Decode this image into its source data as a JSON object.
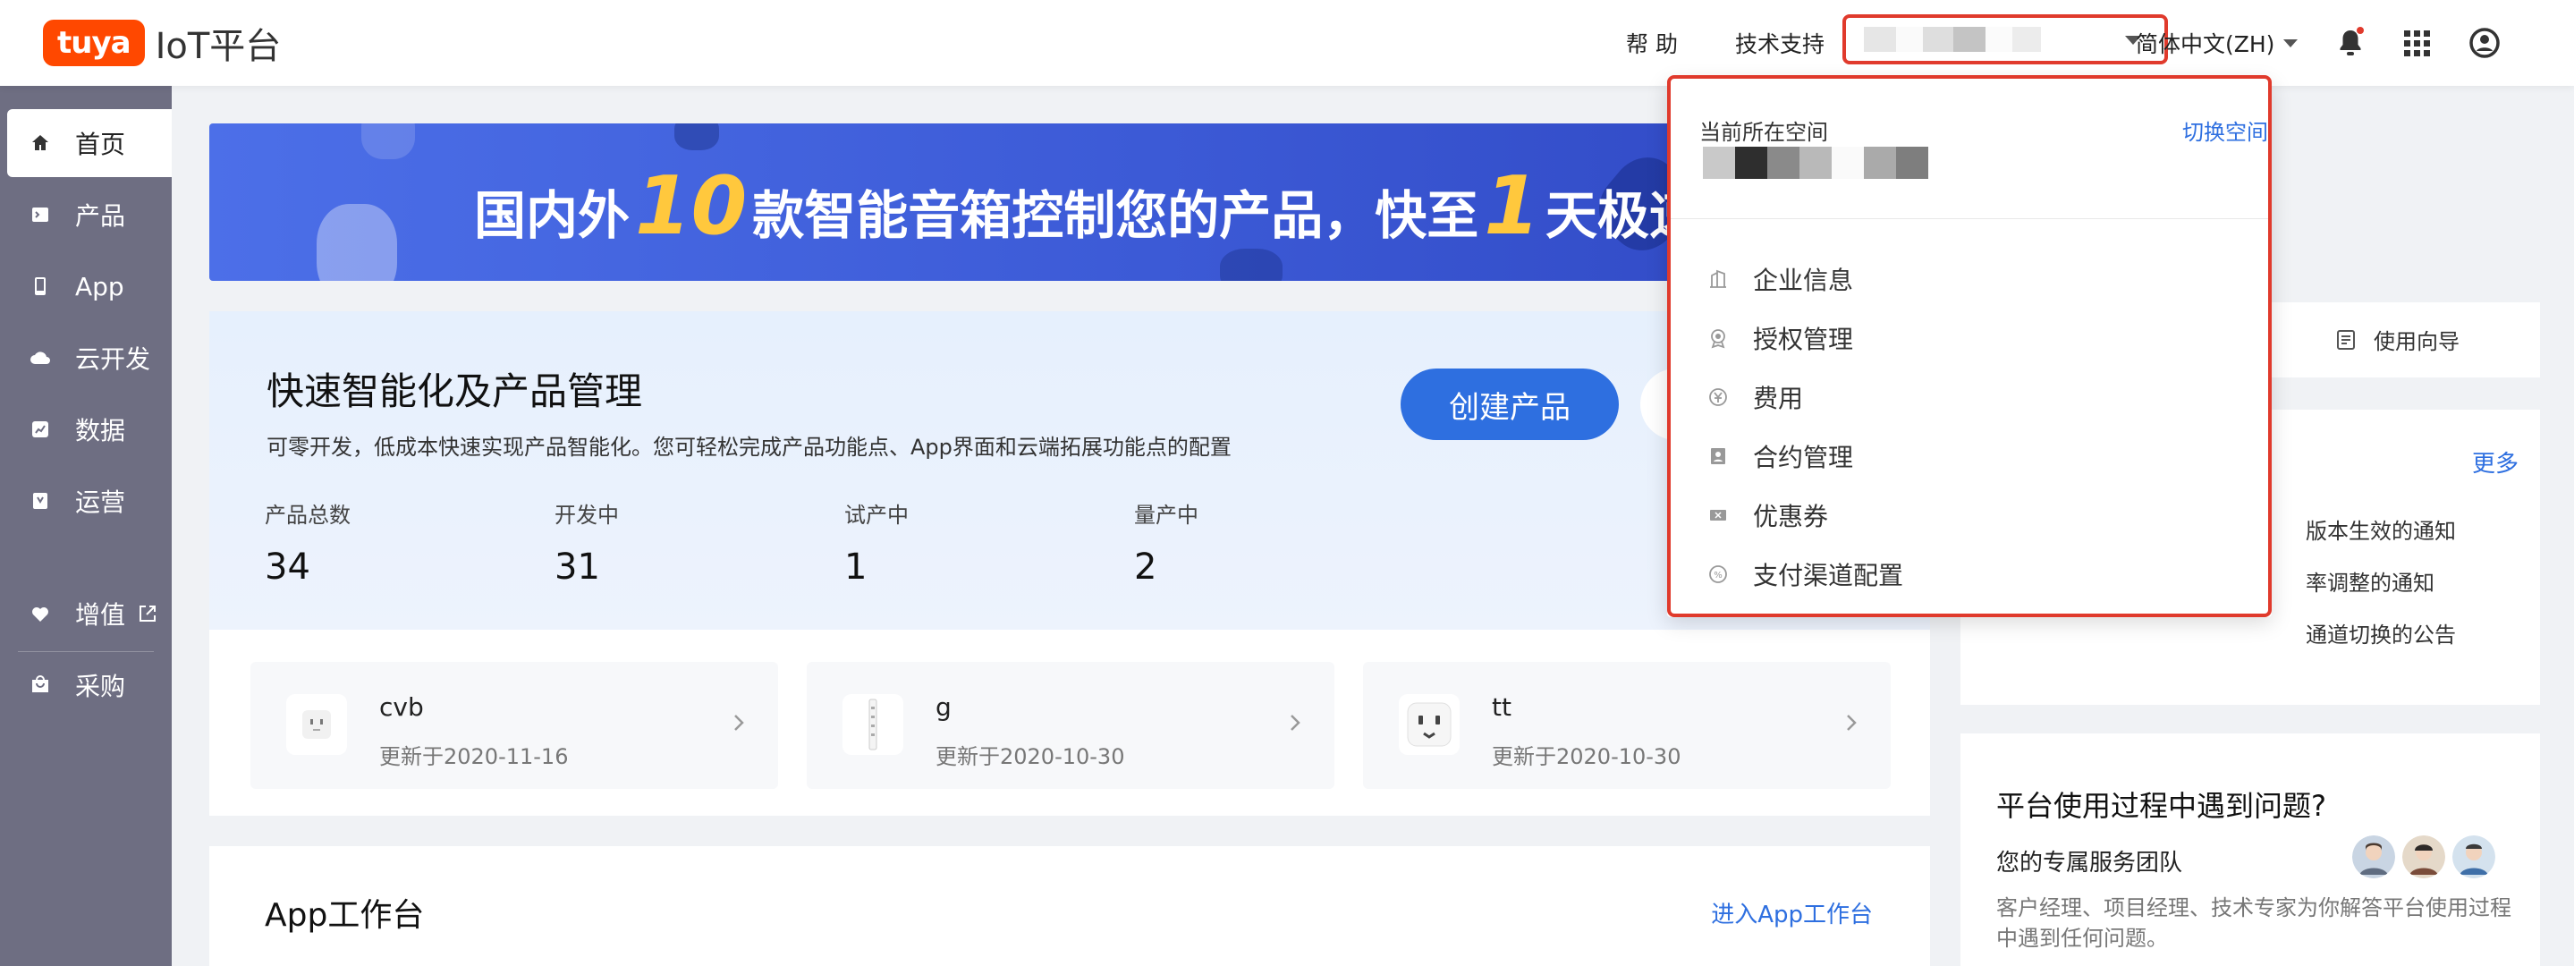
{
  "header": {
    "logo_badge": "tuya",
    "logo_text": "IoT平台",
    "help": "帮 助",
    "support": "技术支持",
    "language": "简体中文(ZH)"
  },
  "sidebar": {
    "items": [
      {
        "label": "首页",
        "icon": "home-icon",
        "active": true
      },
      {
        "label": "产品",
        "icon": "product-icon"
      },
      {
        "label": "App",
        "icon": "phone-icon"
      },
      {
        "label": "云开发",
        "icon": "cloud-icon"
      },
      {
        "label": "数据",
        "icon": "data-icon"
      },
      {
        "label": "运营",
        "icon": "operation-icon"
      },
      {
        "label": "增值",
        "icon": "heart-icon",
        "external": true
      },
      {
        "label": "采购",
        "icon": "purchase-icon"
      }
    ]
  },
  "banner": {
    "part1": "国内外",
    "num1": "10",
    "part2": "款智能音箱控制您的产品，快至",
    "num2": "1",
    "part3": "天极速"
  },
  "quick": {
    "title": "快速智能化及产品管理",
    "desc": "可零开发，低成本快速实现产品智能化。您可轻松完成产品功能点、App界面和云端拓展功能点的配置",
    "create_button": "创建产品",
    "stats": [
      {
        "label": "产品总数",
        "value": "34"
      },
      {
        "label": "开发中",
        "value": "31"
      },
      {
        "label": "试产中",
        "value": "1"
      },
      {
        "label": "量产中",
        "value": "2"
      }
    ]
  },
  "products": [
    {
      "name": "cvb",
      "date": "更新于2020-11-16"
    },
    {
      "name": "g",
      "date": "更新于2020-10-30"
    },
    {
      "name": "tt",
      "date": "更新于2020-10-30"
    }
  ],
  "app_workbench": {
    "title": "App工作台",
    "link": "进入App工作台"
  },
  "guide": {
    "label": "使用向导"
  },
  "news": {
    "more": "更多",
    "items": [
      "版本生效的通知",
      "率调整的通知",
      "通道切换的公告"
    ]
  },
  "help": {
    "title": "平台使用过程中遇到问题?",
    "subtitle": "您的专属服务团队",
    "desc": "客户经理、项目经理、技术专家为你解答平台使用过程中遇到任何问题。"
  },
  "dropdown": {
    "current_label": "当前所在空间",
    "switch_label": "切换空间",
    "items": [
      {
        "label": "企业信息",
        "icon": "building-icon"
      },
      {
        "label": "授权管理",
        "icon": "badge-icon"
      },
      {
        "label": "费用",
        "icon": "fee-icon"
      },
      {
        "label": "合约管理",
        "icon": "contract-icon"
      },
      {
        "label": "优惠券",
        "icon": "coupon-icon"
      },
      {
        "label": "支付渠道配置",
        "icon": "payment-icon"
      }
    ]
  },
  "colors": {
    "brand_orange": "#ff4800",
    "primary_blue": "#2e6fe0",
    "highlight_red": "#e03a2c",
    "sidebar_bg": "#6e6e82"
  }
}
